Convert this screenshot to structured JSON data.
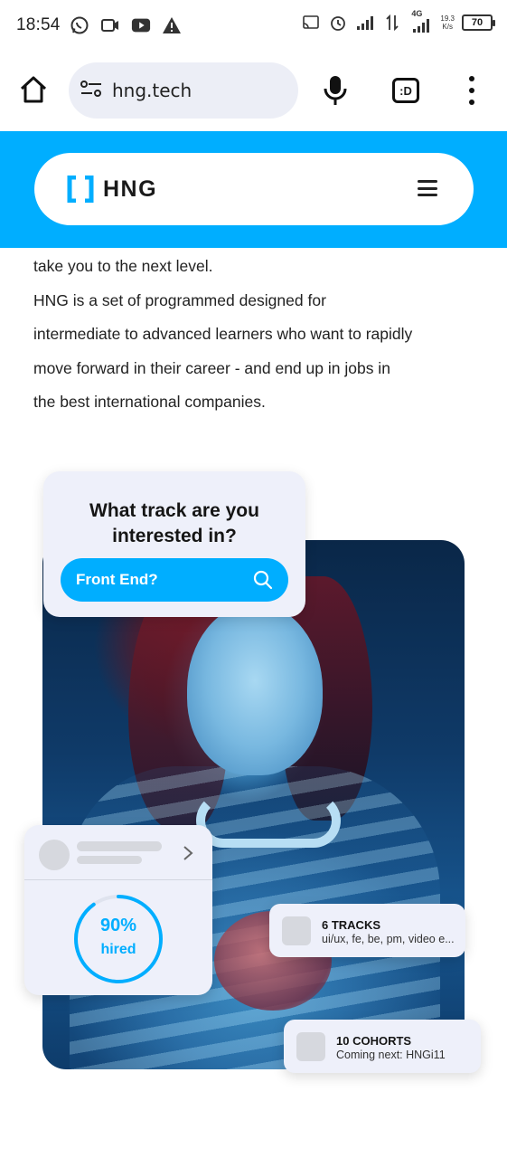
{
  "status_bar": {
    "time": "18:54",
    "left_icons": [
      "whatsapp-icon",
      "video-call-icon",
      "youtube-icon",
      "warning-icon"
    ],
    "right_icons": [
      "cast-icon",
      "alarm-icon",
      "signal-icon",
      "data-transfer-icon",
      "signal-4g-icon"
    ],
    "network_type": "4G",
    "net_speed_value": "19.3",
    "net_speed_unit": "K/s",
    "battery_level": "70"
  },
  "browser": {
    "url": "hng.tech",
    "tabs_label": ":D",
    "icons": [
      "home-icon",
      "site-settings-icon",
      "mic-icon",
      "tabs-icon",
      "more-vert-icon"
    ]
  },
  "header": {
    "logo_text": "HNG",
    "accent_color": "#00aeff"
  },
  "intro": {
    "line1": "take you to the next level.",
    "line2": "HNG is a set of programmed designed for",
    "line3": "intermediate to advanced learners who want to rapidly",
    "line4": "move forward in their career - and end up in jobs in",
    "line5": "the best international companies."
  },
  "track_card": {
    "title_line1": "What track are you",
    "title_line2": "interested in?",
    "search_text": "Front End?"
  },
  "hired_card": {
    "percent_text": "90%",
    "label": "hired",
    "ring_fill": 0.9
  },
  "tracks_card": {
    "title": "6 TRACKS",
    "subtitle": "ui/ux, fe, be, pm, video e..."
  },
  "cohorts_card": {
    "title": "10 COHORTS",
    "subtitle": "Coming next: HNGi11"
  }
}
